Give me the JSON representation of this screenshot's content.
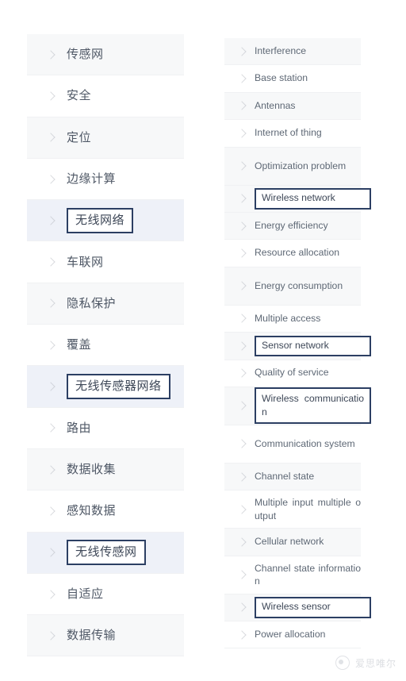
{
  "left_column": {
    "name": "chinese-keyword-list",
    "items": [
      {
        "label": "传感网",
        "highlighted": false
      },
      {
        "label": "安全",
        "highlighted": false
      },
      {
        "label": "定位",
        "highlighted": false
      },
      {
        "label": "边缘计算",
        "highlighted": false
      },
      {
        "label": "无线网络",
        "highlighted": true
      },
      {
        "label": "车联网",
        "highlighted": false
      },
      {
        "label": "隐私保护",
        "highlighted": false
      },
      {
        "label": "覆盖",
        "highlighted": false
      },
      {
        "label": "无线传感器网络",
        "highlighted": true
      },
      {
        "label": "路由",
        "highlighted": false
      },
      {
        "label": "数据收集",
        "highlighted": false
      },
      {
        "label": "感知数据",
        "highlighted": false
      },
      {
        "label": "无线传感网",
        "highlighted": true
      },
      {
        "label": "自适应",
        "highlighted": false
      },
      {
        "label": "数据传输",
        "highlighted": false
      }
    ]
  },
  "right_column": {
    "name": "english-keyword-list",
    "items": [
      {
        "label": "Interference",
        "highlighted": false,
        "two_line": false
      },
      {
        "label": "Base station",
        "highlighted": false,
        "two_line": false
      },
      {
        "label": "Antennas",
        "highlighted": false,
        "two_line": false
      },
      {
        "label": "Internet of thing",
        "highlighted": false,
        "two_line": false
      },
      {
        "label": "Optimization problem",
        "highlighted": false,
        "two_line": true
      },
      {
        "label": "Wireless network",
        "highlighted": true,
        "two_line": false
      },
      {
        "label": "Energy efficiency",
        "highlighted": false,
        "two_line": false
      },
      {
        "label": "Resource allocation",
        "highlighted": false,
        "two_line": false
      },
      {
        "label": "Energy consumption",
        "highlighted": false,
        "two_line": true
      },
      {
        "label": "Multiple access",
        "highlighted": false,
        "two_line": false
      },
      {
        "label": "Sensor network",
        "highlighted": true,
        "two_line": false
      },
      {
        "label": "Quality of service",
        "highlighted": false,
        "two_line": false
      },
      {
        "label": "Wireless communication",
        "highlighted": true,
        "two_line": true
      },
      {
        "label": "Communication system",
        "highlighted": false,
        "two_line": true
      },
      {
        "label": "Channel state",
        "highlighted": false,
        "two_line": false
      },
      {
        "label": "Multiple input multiple output",
        "highlighted": false,
        "two_line": true
      },
      {
        "label": "Cellular network",
        "highlighted": false,
        "two_line": false
      },
      {
        "label": "Channel state information",
        "highlighted": false,
        "two_line": true
      },
      {
        "label": "Wireless sensor",
        "highlighted": true,
        "two_line": false
      },
      {
        "label": "Power allocation",
        "highlighted": false,
        "two_line": false
      }
    ]
  },
  "watermark": {
    "text": "爱思唯尔",
    "logo": "circle-logo-icon"
  },
  "colors": {
    "row_alt_background": "#f7f8f9",
    "row_background": "#ffffff",
    "selected_row_background": "#eef1f8",
    "highlight_border": "#2c3f63",
    "label_text": "#5e6875",
    "chevron": "#b9bcc3"
  }
}
